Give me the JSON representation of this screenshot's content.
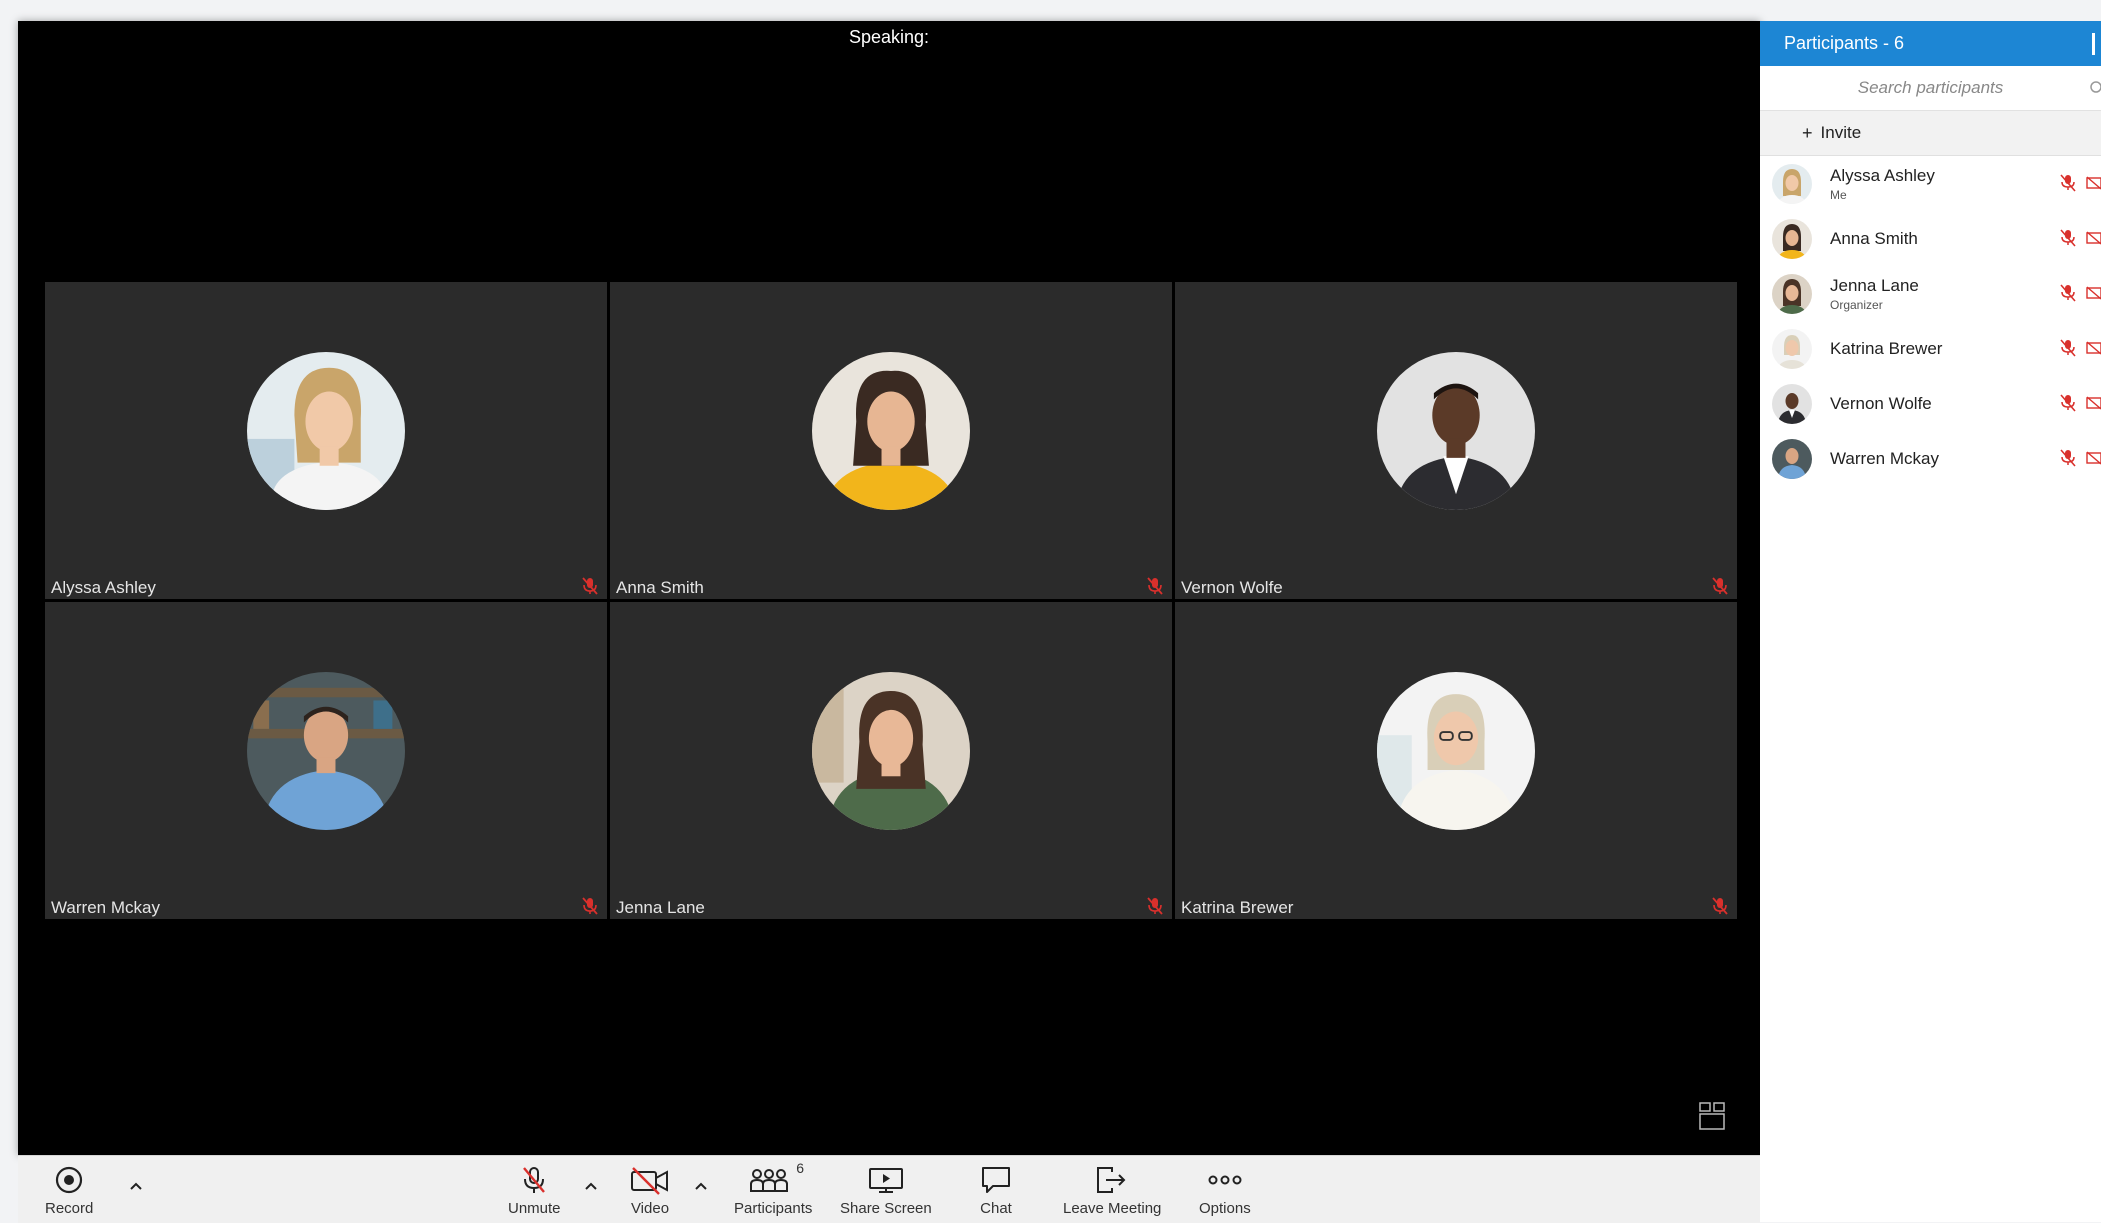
{
  "stage": {
    "speaking_label": "Speaking:",
    "tiles": [
      {
        "name": "Alyssa Ashley"
      },
      {
        "name": "Anna Smith"
      },
      {
        "name": "Vernon Wolfe"
      },
      {
        "name": "Warren Mckay"
      },
      {
        "name": "Jenna Lane"
      },
      {
        "name": "Katrina Brewer"
      }
    ]
  },
  "toolbar": {
    "record": "Record",
    "unmute": "Unmute",
    "video": "Video",
    "participants": "Participants",
    "participants_count": "6",
    "share_screen": "Share Screen",
    "chat": "Chat",
    "leave_meeting": "Leave Meeting",
    "options": "Options"
  },
  "panel": {
    "title": "Participants - 6",
    "search_placeholder": "Search participants",
    "invite": "Invite",
    "participants": [
      {
        "name": "Alyssa Ashley",
        "role": "Me"
      },
      {
        "name": "Anna Smith",
        "role": ""
      },
      {
        "name": "Jenna Lane",
        "role": "Organizer"
      },
      {
        "name": "Katrina Brewer",
        "role": ""
      },
      {
        "name": "Vernon Wolfe",
        "role": ""
      },
      {
        "name": "Warren Mckay",
        "role": ""
      }
    ]
  },
  "colors": {
    "accent": "#1d86d4",
    "muted_red": "#d9302c",
    "tile_bg": "#2b2b2b"
  }
}
